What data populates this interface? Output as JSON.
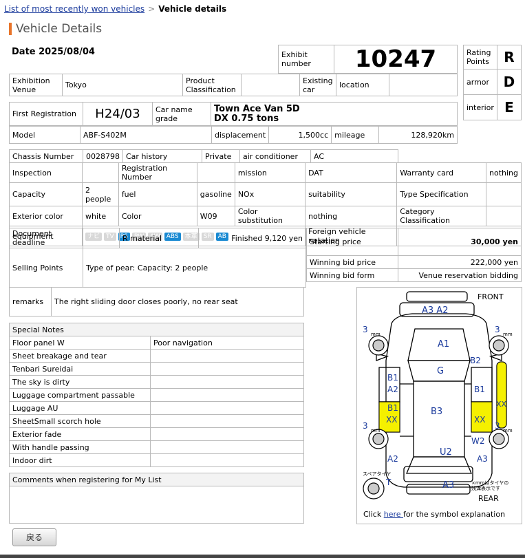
{
  "breadcrumb": {
    "link": "List of most recently won vehicles",
    "sep": ">",
    "current": "Vehicle details"
  },
  "page_title": "Vehicle Details",
  "date_text": "Date 2025/08/04",
  "exhibit": {
    "label": "Exhibit number",
    "value": "10247"
  },
  "rating": {
    "points_label": "Rating Points",
    "points": "R",
    "armor_label": "armor",
    "armor": "D",
    "interior_label": "interior",
    "interior": "E"
  },
  "venue": {
    "label": "Exhibition Venue",
    "value": "Tokyo",
    "product_label": "Product Classification",
    "product_value": "",
    "existing_label": "Existing car",
    "location_label": "location",
    "location_value": ""
  },
  "registration": {
    "label": "First Registration",
    "value": "H24/03",
    "carname_label": "Car name grade",
    "carname_line1": "Town Ace Van 5D",
    "carname_line2": "DX 0.75 tons"
  },
  "model": {
    "label": "Model",
    "value": "ABF-S402M",
    "disp_label": "displacement",
    "disp_value": "1,500cc",
    "mileage_label": "mileage",
    "mileage_value": "128,920km"
  },
  "details": {
    "chassis_label": "Chassis Number",
    "chassis": "0028798",
    "history_label": "Car history",
    "history": "Private",
    "ac_label": "air conditioner",
    "ac": "AC",
    "inspection_label": "Inspection",
    "inspection": "",
    "regnum_label": "Registration Number",
    "regnum": "",
    "mission_label": "mission",
    "mission": "DAT",
    "warranty_label": "Warranty card",
    "warranty": "nothing",
    "capacity_label": "Capacity",
    "capacity": "2 people",
    "fuel_label": "fuel",
    "fuel": "gasoline",
    "nox_label": "NOx",
    "nox": "",
    "suitability_label": "suitability",
    "suitability": "",
    "typespec_label": "Type Specification",
    "typespec": "",
    "extcolor_label": "Exterior color",
    "extcolor": "white",
    "color_label": "Color",
    "color": "W09",
    "colorsub_label": "Color substitution",
    "colorsub": "nothing",
    "category_label": "Category Classification",
    "category": "",
    "equipment_label": "equipment",
    "foreign_label": "Foreign vehicle notation",
    "foreign": "",
    "docdeadline_label": "Document deadline",
    "docdeadline": "",
    "rmaterial_label": "R material",
    "rmaterial": "Finished 9,120 yen",
    "starting_label": "Starting price",
    "starting": "30,000 yen",
    "selling_label": "Selling Points",
    "selling": "Type of pear: Capacity: 2 people",
    "winning_label": "Winning bid price",
    "winning": "222,000 yen",
    "winform_label": "Winning bid form",
    "winform": "Venue reservation bidding"
  },
  "equipment": [
    {
      "name": "ナビ",
      "on": false
    },
    {
      "name": "TV",
      "on": false
    },
    {
      "name": "PS",
      "on": true
    },
    {
      "name": "PW",
      "on": false
    },
    {
      "name": "AW",
      "on": false
    },
    {
      "name": "ABS",
      "on": true
    },
    {
      "name": "本革",
      "on": false
    },
    {
      "name": "SR",
      "on": false
    },
    {
      "name": "AB",
      "on": true
    }
  ],
  "remarks": {
    "label": "remarks",
    "value": "The right sliding door closes poorly, no rear seat"
  },
  "special_notes": {
    "header": "Special Notes",
    "rows": [
      [
        "Floor panel W",
        "Poor navigation"
      ],
      [
        "Sheet breakage and tear",
        ""
      ],
      [
        "Tenbari Sureidai",
        ""
      ],
      [
        "The sky is dirty",
        ""
      ],
      [
        "Luggage compartment passable",
        ""
      ],
      [
        "Luggage AU",
        ""
      ],
      [
        "SheetSmall scorch hole",
        ""
      ],
      [
        "Exterior fade",
        ""
      ],
      [
        "With handle passing",
        ""
      ],
      [
        "Indoor dirt",
        ""
      ]
    ]
  },
  "mylist": {
    "header": "Comments when registering for My List"
  },
  "diagram": {
    "front": "FRONT",
    "rear": "REAR",
    "spare": "スペアタイヤ",
    "mm_note_1": "×mmはタイヤの",
    "mm_note_2": "残溝表示です",
    "tire_fl": "3",
    "tire_fr": "3",
    "tire_rl": "3",
    "tire_rr": "3",
    "mm": "mm",
    "marks": {
      "front_bumper": "A3 A2",
      "hood": "A1",
      "right_front_fender": "B2",
      "roof": "G",
      "left_door_upper": "B1",
      "left_door_upper2": "A2",
      "left_door_lower": "B1",
      "left_door_lower2": "XX",
      "center": "B3",
      "right_door_upper": "B1",
      "right_door_lower": "XX",
      "right_panel_ext": "XX",
      "right_rear": "W2",
      "back_door": "U2",
      "left_rear": "A2",
      "right_rear_q": "A3",
      "rear_bumper": "A3",
      "spare_t": "T"
    },
    "click_pre": "Click ",
    "click_link": "here ",
    "click_post": "for the symbol explanation",
    "highlight": "#f5f000"
  },
  "back_button": "戻る"
}
